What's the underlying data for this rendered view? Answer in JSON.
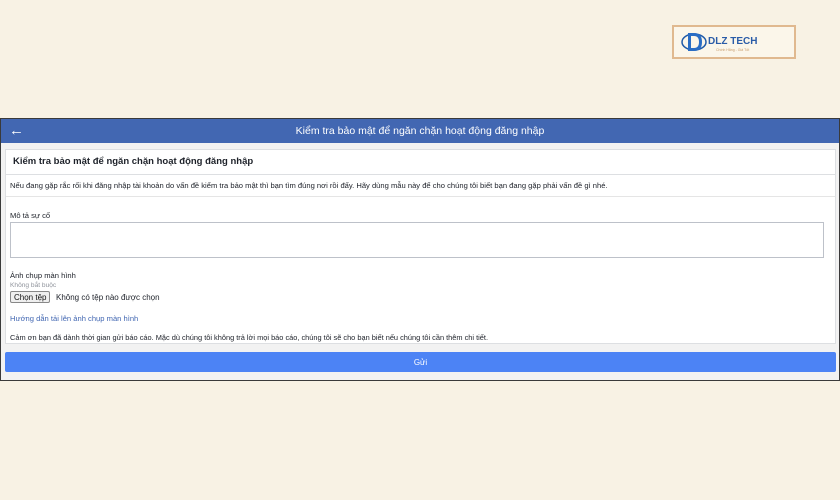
{
  "logo": {
    "text": "DLZ TECH",
    "tagline": "Chính Hãng - Giá Tốt"
  },
  "topbar": {
    "back_icon": "arrow-left-icon",
    "title": "Kiểm tra bảo mật để ngăn chặn hoạt động đăng nhập"
  },
  "card": {
    "title": "Kiểm tra bảo mật để ngăn chặn hoạt động đăng nhập",
    "intro": "Nếu đang gặp rắc rối khi đăng nhập tài khoản do vấn đề kiểm tra bảo mật thì bạn tìm đúng nơi rồi đấy. Hãy dùng mẫu này để cho chúng tôi biết bạn đang gặp phải vấn đề gì nhé.",
    "description_label": "Mô tả sự cố",
    "description_value": "",
    "screenshot_label": "Ảnh chụp màn hình",
    "optional_note": "Không bắt buộc",
    "file_button": "Chọn tệp",
    "file_status": "Không có tệp nào được chọn",
    "help_link": "Hướng dẫn tải lên ảnh chụp màn hình",
    "thanks": "Cảm ơn bạn đã dành thời gian gửi báo cáo. Mặc dù chúng tôi không trả lời mọi báo cáo, chúng tôi sẽ cho bạn biết nếu chúng tôi cần thêm chi tiết."
  },
  "submit_label": "Gửi",
  "colors": {
    "brand_blue": "#4267b2",
    "submit_blue": "#4c83f5",
    "page_bg": "#f8f2e4"
  }
}
